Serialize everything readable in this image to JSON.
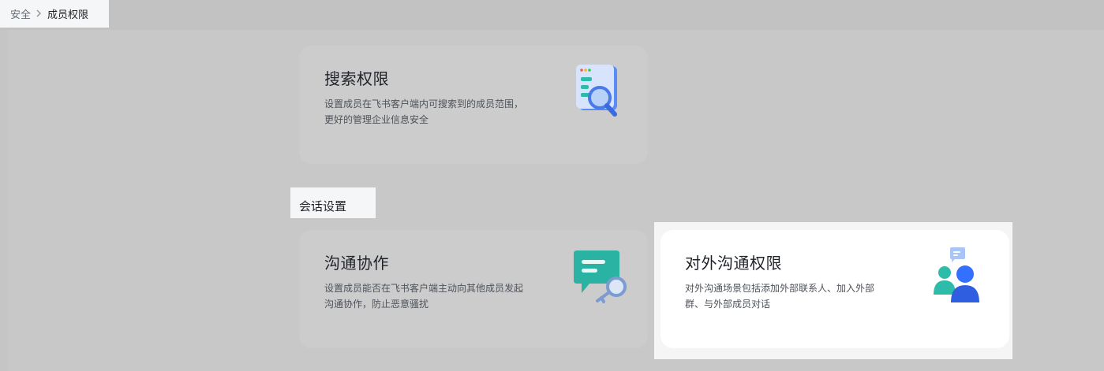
{
  "breadcrumb": {
    "parent": "安全",
    "separator": ">",
    "current": "成员权限"
  },
  "cards": {
    "search": {
      "title": "搜索权限",
      "desc_line1": "设置成员在飞书客户端内可搜索到的成员范围，",
      "desc_line2": "更好的管理企业信息安全",
      "icon": "search-magnifier-illustration"
    },
    "collab": {
      "title": "沟通协作",
      "desc_line1": "设置成员能否在飞书客户端主动向其他成员发起",
      "desc_line2": "沟通协作，防止恶意骚扰",
      "icon": "chat-bubble-key-illustration"
    },
    "external": {
      "title": "对外沟通权限",
      "desc_line1": "对外沟通场景包括添加外部联系人、加入外部",
      "desc_line2": "群、与外部成员对话",
      "icon": "people-chat-illustration"
    }
  },
  "section": {
    "session_settings": "会话设置"
  },
  "colors": {
    "accent_blue": "#3370ff",
    "accent_teal": "#2ebcaa",
    "overlay": "#c8c8c9"
  }
}
